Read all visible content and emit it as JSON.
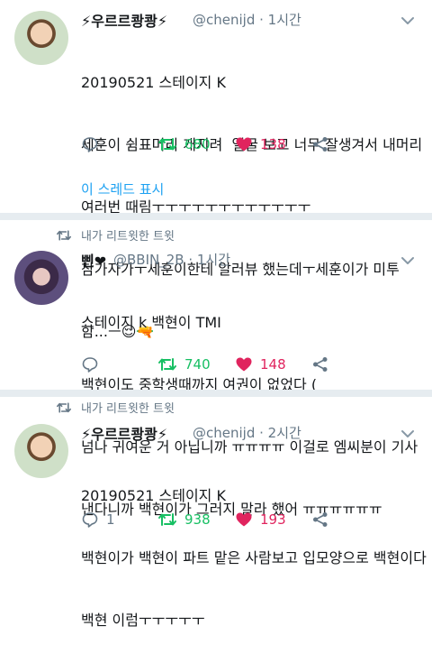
{
  "tweets": [
    {
      "display_name": "⚡우르르쾅쾅⚡",
      "handle": "@chenijd",
      "time": "· 1시간",
      "lines": [
        "20190521 스테이지 K",
        "세훈이 쉼표머리 개지려  얼굴 보고 너무 잘생겨서 내머리",
        "여러번 때림ㅜㅜㅜㅜㅜㅜㅜㅜㅜㅜㅜㅜ",
        "참가자가ㅜ세훈이한테 알러뷰 했는데ㅜ세훈이가 미투",
        "함...ㅡ😌🔫"
      ],
      "replies": "",
      "retweets": "680",
      "likes": "138",
      "thread_link": "이 스레드 표시"
    },
    {
      "retweet_banner": "내가 리트윗한 트윗",
      "display_name": "삔❤",
      "handle": "@BBIN_2B",
      "time": "· 1시간",
      "lines": [
        "스테이지 k 백현이 TMI",
        "백현이도 중학생때까지 여권이 없었다 (",
        "넘나 귀여운 거 아닙니까 ㅠㅠㅠㅠ 이걸로 엠씨분이 기사",
        "낸다니까 백현이가 그러지 말라 했어 ㅠㅠㅠㅠㅠㅠ"
      ],
      "replies": "",
      "retweets": "740",
      "likes": "148"
    },
    {
      "retweet_banner": "내가 리트윗한 트윗",
      "display_name": "⚡우르르쾅쾅⚡",
      "handle": "@chenijd",
      "time": "· 2시간",
      "lines": [
        "20190521 스테이지 K",
        "백현이가 백현이 파트 맡은 사람보고 입모양으로 백현이다",
        "백현 이럼ㅜㅜㅜㅜㅜ"
      ],
      "replies": "1",
      "retweets": "938",
      "likes": "193"
    }
  ],
  "icons": {
    "reply": "reply-icon",
    "retweet": "retweet-icon",
    "like": "heart-icon",
    "share": "share-icon",
    "more": "chevron-down-icon"
  },
  "colors": {
    "retweet": "#17bf63",
    "like": "#e0245e",
    "link": "#1da1f2",
    "muted": "#657786"
  }
}
